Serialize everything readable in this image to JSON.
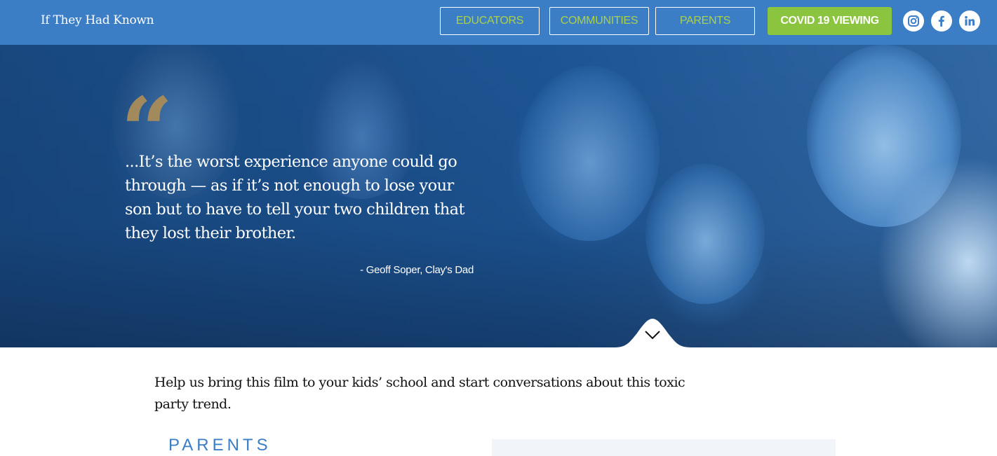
{
  "header": {
    "site_title": "If They Had Known",
    "nav": {
      "educators": "EDUCATORS",
      "communities": "COMMUNITIES",
      "parents": "PARENTS",
      "covid": "COVID 19 VIEWING"
    },
    "social": [
      "instagram-icon",
      "facebook-icon",
      "linkedin-icon"
    ]
  },
  "hero": {
    "quote_mark": "“",
    "quote": "...It’s the worst experience anyone could go through — as if it’s not enough to lose your son but to have to tell your two children that they lost their brother.",
    "attribution": "- Geoff Soper, Clay's Dad",
    "scroll_icon": "chevron-down-icon"
  },
  "main": {
    "intro": "Help us bring this film to your kids’ school and start conversations about this toxic party trend.",
    "section_heading": "PARENTS"
  },
  "colors": {
    "header_bg": "#3b7ec6",
    "nav_text": "#a9d14a",
    "covid_bg": "#8bc43f",
    "quote_mark": "#a38a5c",
    "heading": "#3b7ec6"
  }
}
